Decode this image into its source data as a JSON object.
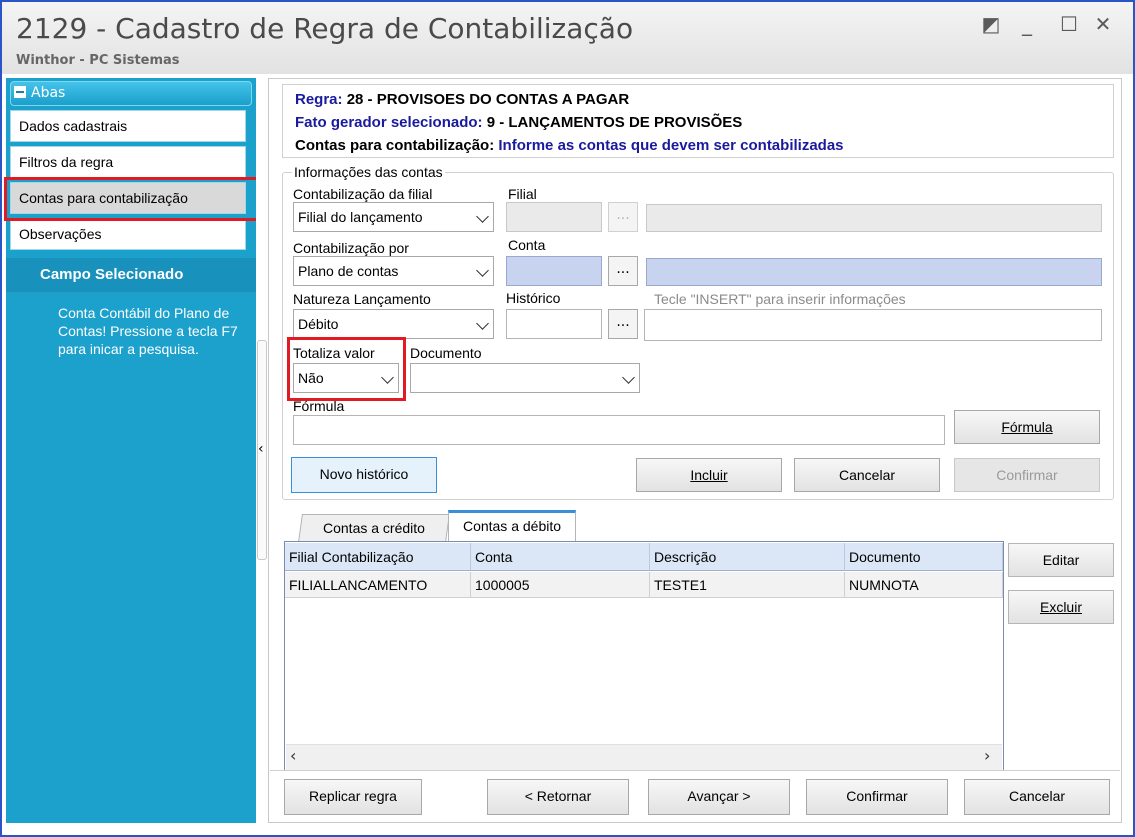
{
  "window": {
    "title": "2129 - Cadastro de Regra de Contabilização",
    "subtitle": "Winthor - PC Sistemas"
  },
  "sidebar": {
    "header": "Abas",
    "items": [
      {
        "label": "Dados cadastrais"
      },
      {
        "label": "Filtros da regra"
      },
      {
        "label": "Contas para contabilização",
        "selected": true
      },
      {
        "label": "Observações"
      }
    ],
    "campo_title": "Campo Selecionado",
    "campo_text": "Conta Contábil do Plano de Contas! Pressione a tecla F7 para inicar a pesquisa."
  },
  "info": {
    "regra_label": "Regra:",
    "regra_value": "28 - PROVISOES DO CONTAS A PAGAR",
    "fato_label": "Fato gerador selecionado:",
    "fato_value": "9 - LANÇAMENTOS DE PROVISÕES",
    "contas_label": "Contas para contabilização:",
    "contas_value": "Informe as contas que devem ser contabilizadas"
  },
  "form": {
    "group_title": "Informações das contas",
    "contab_filial_label": "Contabilização da filial",
    "contab_filial_value": "Filial do lançamento",
    "filial_label": "Filial",
    "contab_por_label": "Contabilização por",
    "contab_por_value": "Plano de contas",
    "conta_label": "Conta",
    "natureza_label": "Natureza Lançamento",
    "natureza_value": "Débito",
    "historico_label": "Histórico",
    "historico_hint": "Tecle  \"INSERT\" para inserir informações",
    "totaliza_label": "Totaliza valor",
    "totaliza_value": "Não",
    "documento_label": "Documento",
    "documento_value": "",
    "formula_label": "Fórmula",
    "formula_button": "Fórmula",
    "ellipsis": "..."
  },
  "actions": {
    "novo_historico": "Novo histórico",
    "incluir": "Incluir",
    "cancelar": "Cancelar",
    "confirmar": "Confirmar"
  },
  "tabs": [
    {
      "label": "Contas a crédito"
    },
    {
      "label": "Contas a débito",
      "active": true
    }
  ],
  "table": {
    "columns": [
      "Filial Contabilização",
      "Conta",
      "Descrição",
      "Documento"
    ],
    "rows": [
      [
        "FILIALLANCAMENTO",
        "1000005",
        "TESTE1",
        "NUMNOTA"
      ]
    ]
  },
  "table_buttons": {
    "editar": "Editar",
    "excluir": "Excluir"
  },
  "footer": {
    "replicar": "Replicar regra",
    "retornar": "< Retornar",
    "avancar": "Avançar >",
    "confirmar": "Confirmar",
    "cancelar": "Cancelar"
  },
  "colors": {
    "sidebar": "#1ba1cc",
    "highlight_box": "#e11b22",
    "info_blue": "#1a1a9e"
  }
}
